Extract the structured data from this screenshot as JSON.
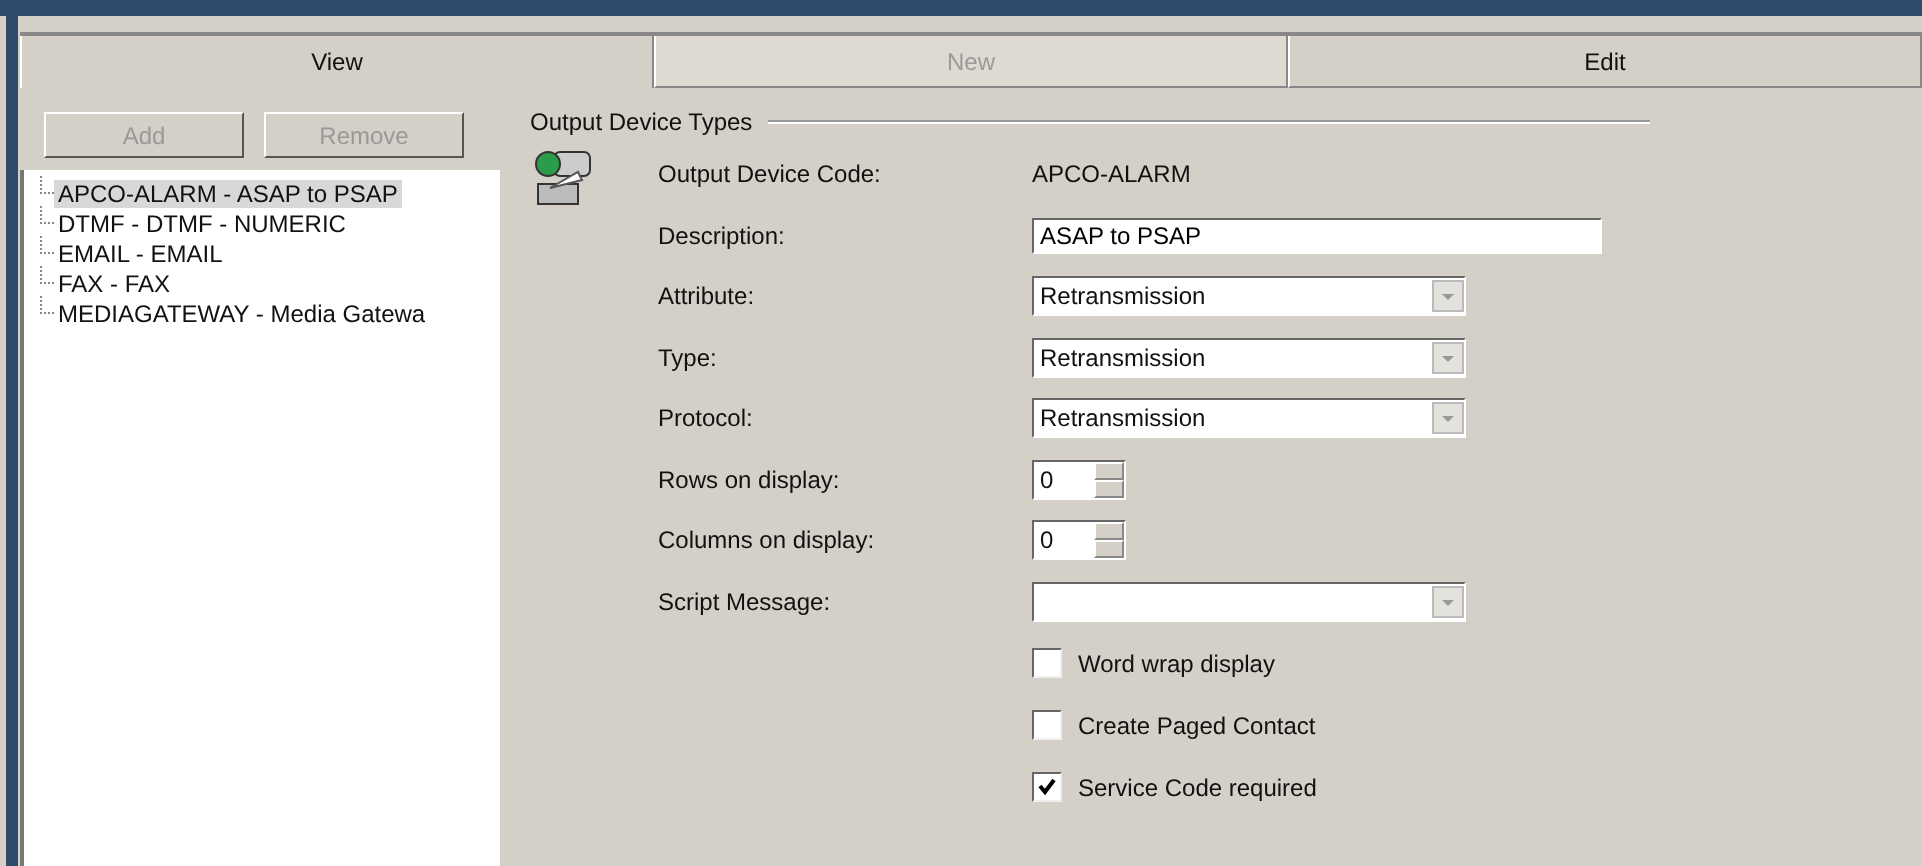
{
  "tabs": [
    {
      "label": "View",
      "selected": true,
      "disabled": false
    },
    {
      "label": "New",
      "selected": false,
      "disabled": true
    },
    {
      "label": "Edit",
      "selected": false,
      "disabled": false
    }
  ],
  "buttons": [
    {
      "label": "Add",
      "disabled": true
    },
    {
      "label": "Remove",
      "disabled": true
    }
  ],
  "tree": [
    {
      "label": "APCO-ALARM - ASAP to PSAP",
      "selected": true
    },
    {
      "label": "DTMF - DTMF - NUMERIC",
      "selected": false
    },
    {
      "label": "EMAIL - EMAIL",
      "selected": false
    },
    {
      "label": "FAX - FAX",
      "selected": false
    },
    {
      "label": "MEDIAGATEWAY - Media Gatewa",
      "selected": false
    }
  ],
  "group_title": "Output Device Types",
  "fields": [
    {
      "kind": "text",
      "label": "Output Device Code:",
      "value": "APCO-ALARM"
    },
    {
      "kind": "input",
      "label": "Description:",
      "value": "ASAP to PSAP"
    },
    {
      "kind": "select",
      "label": "Attribute:",
      "value": "Retransmission"
    },
    {
      "kind": "select",
      "label": "Type:",
      "value": "Retransmission"
    },
    {
      "kind": "select",
      "label": "Protocol:",
      "value": "Retransmission"
    },
    {
      "kind": "spin",
      "label": "Rows on display:",
      "value": "0"
    },
    {
      "kind": "spin",
      "label": "Columns on display:",
      "value": "0"
    },
    {
      "kind": "select",
      "label": "Script Message:"
    }
  ],
  "checkboxes": [
    {
      "label": "Word wrap display",
      "checked": false
    },
    {
      "label": "Create Paged Contact",
      "checked": false
    },
    {
      "label": "Service Code required",
      "checked": true
    }
  ]
}
